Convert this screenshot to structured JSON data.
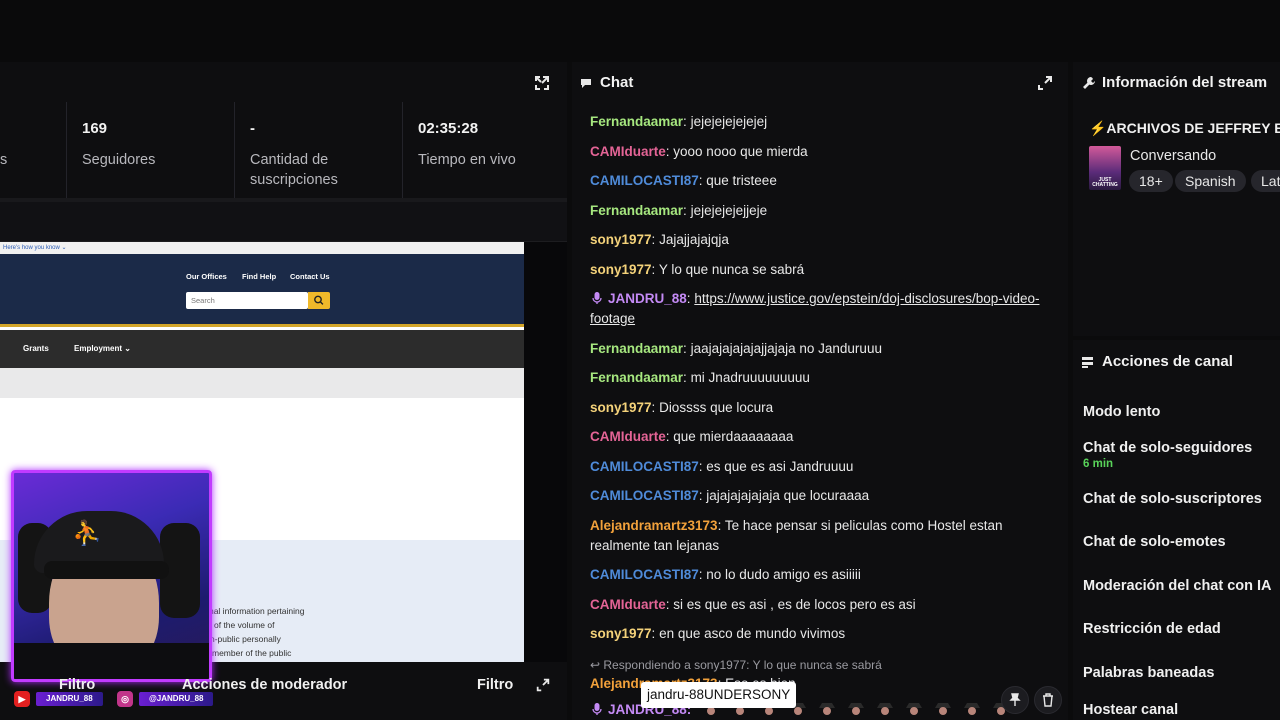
{
  "stats": [
    {
      "value": "",
      "label": "s"
    },
    {
      "value": "169",
      "label": "Seguidores"
    },
    {
      "value": "-",
      "label": "Cantidad de suscripciones"
    },
    {
      "value": "02:35:28",
      "label": "Tiempo en vivo"
    }
  ],
  "video": {
    "top_strip": "Here's how you know ⌄",
    "links": [
      "Our Offices",
      "Find Help",
      "Contact Us"
    ],
    "search_placeholder": "Search",
    "nav": [
      "Grants",
      "Employment ⌄"
    ],
    "text_lines": [
      "sonal information pertaining",
      "of the volume of",
      "n-public personally",
      "member of the public"
    ]
  },
  "socials": {
    "youtube": "JANDRU_88",
    "instagram": "@JANDRU_88"
  },
  "left_bottom": {
    "filter_left": "Filtro",
    "mod_actions": "Acciones de moderador",
    "filter_right": "Filtro"
  },
  "chat": {
    "title": "Chat",
    "messages": [
      {
        "user": "Fernandaamar",
        "color": "#a6e77f",
        "text": " jejejejejejejej"
      },
      {
        "user": "CAMIduarte",
        "color": "#e46496",
        "text": " yooo nooo que mierda"
      },
      {
        "user": "CAMILOCASTI87",
        "color": "#4f8bd9",
        "text": " que tristeee"
      },
      {
        "user": "Fernandaamar",
        "color": "#a6e77f",
        "text": " jejejejejejjeje"
      },
      {
        "user": "sony1977",
        "color": "#f4d27a",
        "text": " Jajajjajajqja"
      },
      {
        "user": "sony1977",
        "color": "#f4d27a",
        "text": " Y lo que nunca se sabrá"
      },
      {
        "user": "JANDRU_88",
        "color": "#c48af5",
        "text": "",
        "link": "https://www.justice.gov/epstein/doj-disclosures/bop-video-footage",
        "mic": true
      },
      {
        "user": "Fernandaamar",
        "color": "#a6e77f",
        "text": " jaajajajajajajjajaja no Janduruuu"
      },
      {
        "user": "Fernandaamar",
        "color": "#a6e77f",
        "text": " mi Jnadruuuuuuuuu"
      },
      {
        "user": "sony1977",
        "color": "#f4d27a",
        "text": " Diossss que locura"
      },
      {
        "user": "CAMIduarte",
        "color": "#e46496",
        "text": " que mierdaaaaaaaa"
      },
      {
        "user": "CAMILOCASTI87",
        "color": "#4f8bd9",
        "text": " es que es asi Jandruuuu"
      },
      {
        "user": "CAMILOCASTI87",
        "color": "#4f8bd9",
        "text": " jajajajajajaja que locuraaaa"
      },
      {
        "user": "Alejandramartz3173",
        "color": "#f2a13b",
        "text": " Te hace pensar si peliculas como Hostel estan realmente tan lejanas"
      },
      {
        "user": "CAMILOCASTI87",
        "color": "#4f8bd9",
        "text": " no lo dudo amigo es asiiiii"
      },
      {
        "user": "CAMIduarte",
        "color": "#e46496",
        "text": " si es que es asi , es de locos pero es asi"
      },
      {
        "user": "sony1977",
        "color": "#f4d27a",
        "text": " en que asco de mundo vivimos"
      }
    ],
    "reply_context": "Respondiendo a sony1977: Y lo que nunca se sabrá",
    "reply_user": "Alejandramartz3173",
    "reply_text": ": Eso es bien",
    "tooltip": "jandru-88UNDERSONY",
    "last_user": "JANDRU_88:"
  },
  "info": {
    "title": "Información del stream",
    "stream_title": "⚡ARCHIVOS DE JEFFREY EP",
    "game_art_label": "JUST CHATTING",
    "category": "Conversando",
    "tags": [
      "18+",
      "Spanish",
      "Lat"
    ]
  },
  "actions": {
    "title": "Acciones de canal",
    "items": [
      {
        "label": "Modo lento"
      },
      {
        "label": "Chat de solo-seguidores",
        "sub": "6 min"
      },
      {
        "label": "Chat de solo-suscriptores"
      },
      {
        "label": "Chat de solo-emotes"
      },
      {
        "label": "Moderación del chat con IA"
      },
      {
        "label": "Restricción de edad"
      },
      {
        "label": "Palabras baneadas"
      },
      {
        "label": "Hostear canal"
      }
    ]
  }
}
